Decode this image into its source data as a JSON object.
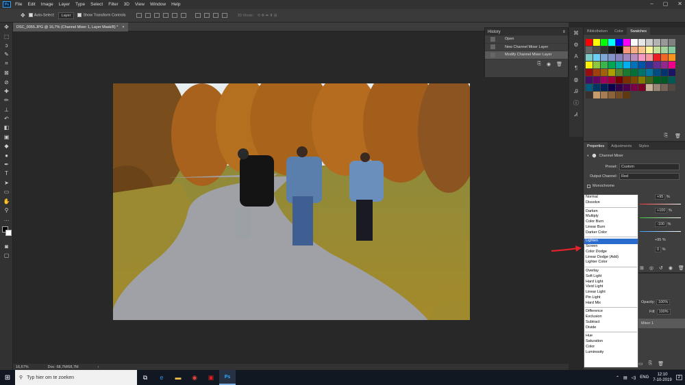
{
  "app": {
    "logo": "Ps",
    "menu": [
      "File",
      "Edit",
      "Image",
      "Layer",
      "Type",
      "Select",
      "Filter",
      "3D",
      "View",
      "Window",
      "Help"
    ]
  },
  "options": {
    "auto_select": "Auto-Select:",
    "target": "Layer",
    "show_transform": "Show Transform Controls",
    "mode_3d": "3D Mode:"
  },
  "doc": {
    "tab_title": "DSC_0055.JPG @ 16,7% (Channel Mixer 1, Layer Mask/8) *",
    "zoom": "16,67%",
    "doc_size": "Doc: 68,7M/68,7M"
  },
  "history": {
    "title": "History",
    "items": [
      "Open",
      "New Channel Mixer Layer",
      "Modify Channel Mixer Layer"
    ]
  },
  "swatch_tabs": [
    "Bibliotheken",
    "Color",
    "Swatches"
  ],
  "properties": {
    "tabs": [
      "Properties",
      "Adjustments",
      "Styles"
    ],
    "name": "Channel Mixer",
    "preset_label": "Preset:",
    "preset_value": "Custom",
    "output_label": "Output Channel:",
    "output_value": "Red",
    "monochrome": "Monochrome",
    "values": [
      "+95",
      "+100",
      "-100",
      "+95",
      "0"
    ],
    "pct": "%"
  },
  "layers": {
    "opacity_label": "Opacity:",
    "opacity": "100%",
    "fill_label": "Fill:",
    "fill": "100%",
    "layer_name": "Mixer 1"
  },
  "blend_groups": [
    [
      "Normal",
      "Dissolve"
    ],
    [
      "Darken",
      "Multiply",
      "Color Burn",
      "Linear Burn",
      "Darker Color"
    ],
    [
      "Lighten",
      "Screen",
      "Color Dodge",
      "Linear Dodge (Add)",
      "Lighter Color"
    ],
    [
      "Overlay",
      "Soft Light",
      "Hard Light",
      "Vivid Light",
      "Linear Light",
      "Pin Light",
      "Hard Mix"
    ],
    [
      "Difference",
      "Exclusion",
      "Subtract",
      "Divide"
    ],
    [
      "Hue",
      "Saturation",
      "Color",
      "Luminosity"
    ]
  ],
  "blend_highlight": "Lighten",
  "taskbar": {
    "search_placeholder": "Typ hier om te zoeken",
    "lang": "ENG",
    "time": "12:10",
    "date": "7-10-2019",
    "notif": "2"
  },
  "colors": {
    "ps_blue": "#31a8ff",
    "highlight": "#2a6bcf",
    "arrow": "#e0242a"
  }
}
